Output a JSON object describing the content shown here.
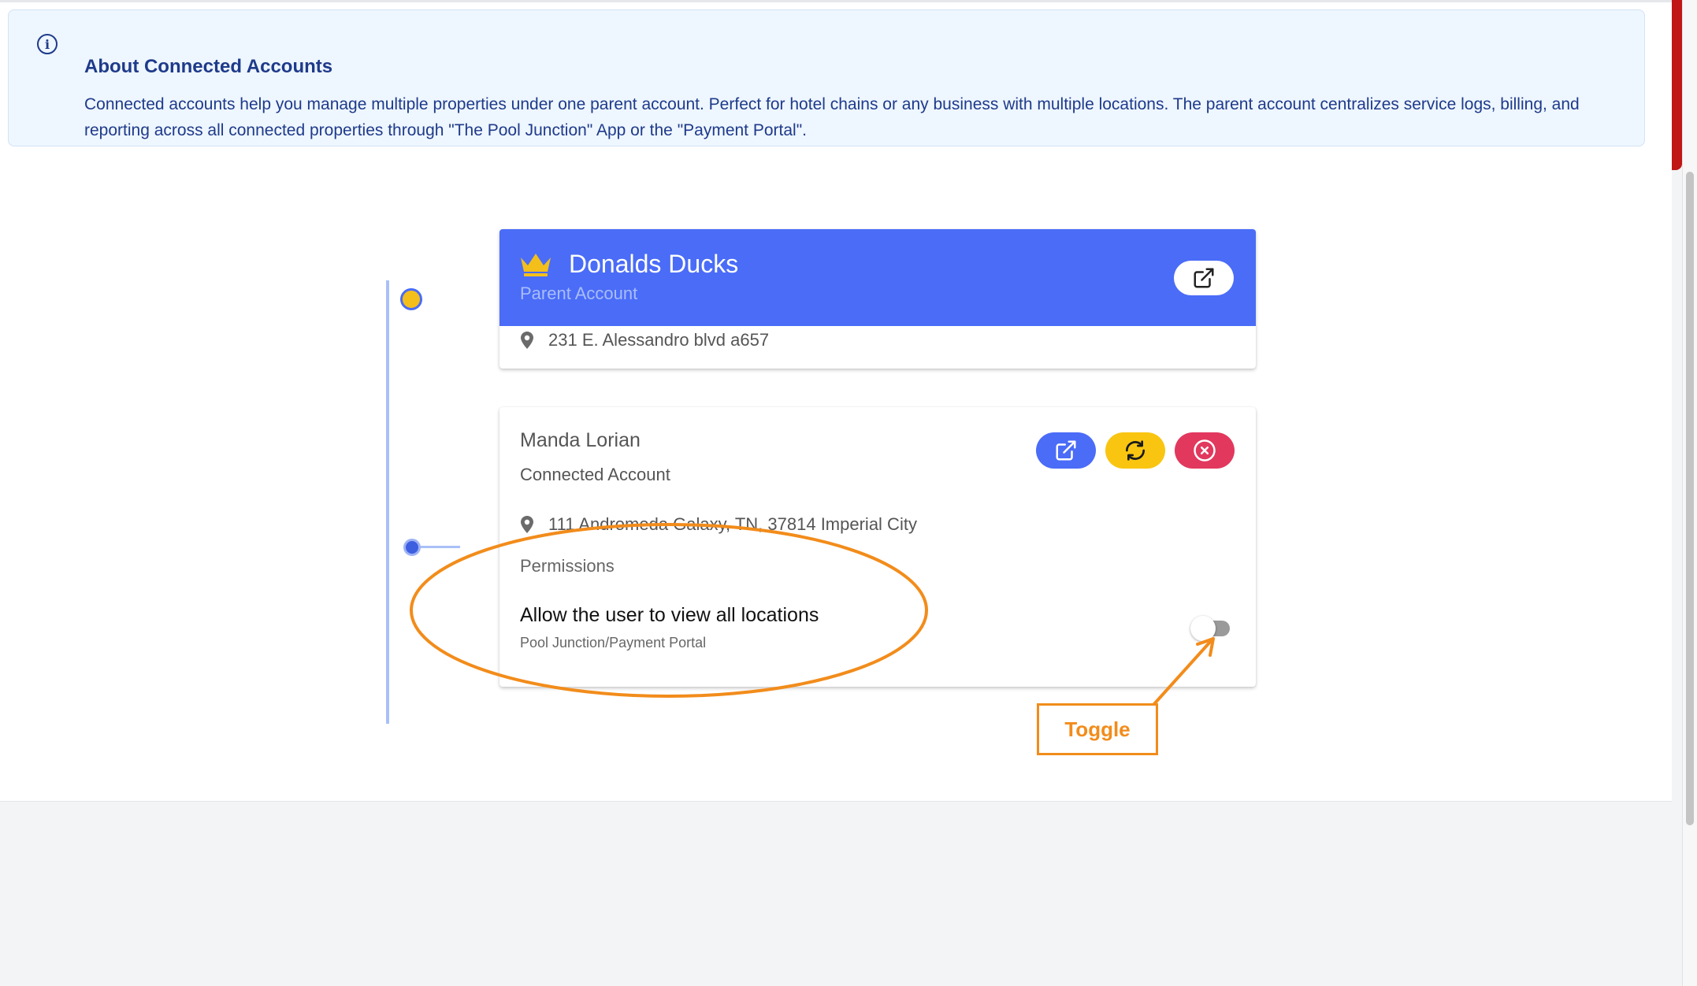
{
  "info": {
    "title": "About Connected Accounts",
    "text": "Connected accounts help you manage multiple properties under one parent account. Perfect for hotel chains or any business with multiple locations. The parent account centralizes service logs, billing, and reporting across all connected properties through \"The Pool Junction\" App or the \"Payment Portal\".",
    "icon": "info-icon"
  },
  "parent": {
    "name": "Donalds Ducks",
    "role": "Parent Account",
    "address": "231 E. Alessandro blvd a657",
    "icons": [
      "crown-icon",
      "location-pin-icon",
      "external-link-icon"
    ]
  },
  "connected": {
    "name": "Manda Lorian",
    "role": "Connected Account",
    "address": "111 Andromeda Galaxy, TN, 37814 Imperial City",
    "permissions_label": "Permissions",
    "permission": {
      "title": "Allow the user to view all locations",
      "subtitle": "Pool Junction/Payment Portal",
      "enabled": false
    },
    "actions": [
      "external-link-icon",
      "sync-icon",
      "remove-icon"
    ]
  },
  "annotation": {
    "callout_label": "Toggle"
  },
  "colors": {
    "primary": "#4a6cf7",
    "sync": "#f9c511",
    "remove": "#e2385e",
    "crown": "#f4bf1b",
    "annotation": "#f28c1b",
    "info_text": "#1e3a8a"
  }
}
